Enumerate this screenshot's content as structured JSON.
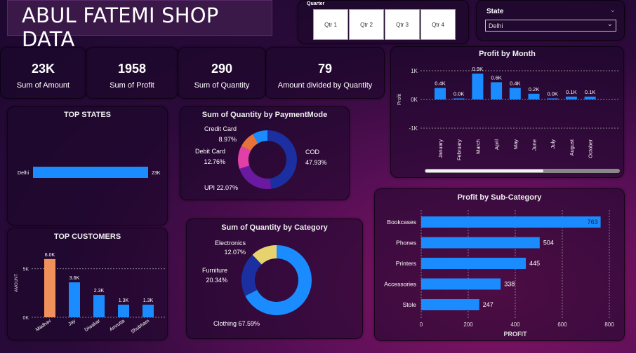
{
  "header": {
    "title": "ABUL FATEMI SHOP DATA"
  },
  "quarter": {
    "label": "Quarter",
    "buttons": [
      "Qtr 1",
      "Qtr 2",
      "Qtr 3",
      "Qtr 4"
    ]
  },
  "state_filter": {
    "label": "State",
    "selected": "Delhi"
  },
  "kpis": [
    {
      "value": "23K",
      "label": "Sum of Amount"
    },
    {
      "value": "1958",
      "label": "Sum of Profit"
    },
    {
      "value": "290",
      "label": "Sum of Quantity"
    },
    {
      "value": "79",
      "label": "Amount divided by Quantity"
    }
  ],
  "colors": {
    "bar": "#1a8cff",
    "highlight": "#f0905a",
    "dark_blue": "#1c2fa0",
    "pink": "#e040a8",
    "purple": "#6a1aa0",
    "orange": "#e8733a",
    "yellow": "#e6d36e"
  },
  "chart_data": [
    {
      "id": "profit_by_month",
      "type": "bar",
      "title": "Profit by Month",
      "ylabel": "Profit",
      "categories": [
        "January",
        "February",
        "March",
        "April",
        "May",
        "June",
        "July",
        "August",
        "October"
      ],
      "values": [
        400,
        0,
        900,
        600,
        400,
        200,
        0,
        100,
        100
      ],
      "data_labels": [
        "0.4K",
        "0.0K",
        "0.9K",
        "0.6K",
        "0.4K",
        "0.2K",
        "0.0K",
        "0.1K",
        "0.1K"
      ],
      "ylim": [
        -1000,
        1000
      ],
      "yticks": [
        1000,
        0,
        -1000
      ],
      "ytick_labels": [
        "1K",
        "0K",
        "-1K"
      ]
    },
    {
      "id": "top_states",
      "type": "bar",
      "orientation": "horizontal",
      "title": "TOP STATES",
      "categories": [
        "Delhi"
      ],
      "values": [
        23000
      ],
      "data_labels": [
        "23K"
      ]
    },
    {
      "id": "payment_mode",
      "type": "pie",
      "donut": true,
      "title": "Sum of Quantity by PaymentMode",
      "slices": [
        {
          "label": "COD",
          "value": 47.93,
          "pct": "47.93%"
        },
        {
          "label": "UPI",
          "value": 22.07,
          "pct": "22.07%"
        },
        {
          "label": "Debit Card",
          "value": 12.76,
          "pct": "12.76%"
        },
        {
          "label": "Credit Card",
          "value": 8.97,
          "pct": "8.97%"
        },
        {
          "label": "",
          "value": 8.27,
          "pct": ""
        }
      ]
    },
    {
      "id": "top_customers",
      "type": "bar",
      "title": "TOP CUSTOMERS",
      "ylabel": "AMOUNT",
      "categories": [
        "Madhav",
        "Jay",
        "Diwakar",
        "Amrutta",
        "Shubham"
      ],
      "values": [
        6000,
        3600,
        2300,
        1300,
        1300
      ],
      "data_labels": [
        "6.0K",
        "3.6K",
        "2.3K",
        "1.3K",
        "1.3K"
      ],
      "ylim": [
        0,
        7000
      ],
      "yticks": [
        0,
        5000
      ],
      "ytick_labels": [
        "0K",
        "5K"
      ]
    },
    {
      "id": "category",
      "type": "pie",
      "donut": true,
      "title": "Sum of Quantity by Category",
      "slices": [
        {
          "label": "Clothing",
          "value": 67.59,
          "pct": "67.59%"
        },
        {
          "label": "Furniture",
          "value": 20.34,
          "pct": "20.34%"
        },
        {
          "label": "Electronics",
          "value": 12.07,
          "pct": "12.07%"
        }
      ]
    },
    {
      "id": "sub_category",
      "type": "bar",
      "orientation": "horizontal",
      "title": "Profit by Sub-Category",
      "xlabel": "PROFIT",
      "categories": [
        "Bookcases",
        "Phones",
        "Printers",
        "Accessories",
        "Stole"
      ],
      "values": [
        763,
        504,
        445,
        338,
        247
      ],
      "xlim": [
        0,
        800
      ],
      "xticks": [
        0,
        200,
        400,
        600,
        800
      ]
    }
  ]
}
